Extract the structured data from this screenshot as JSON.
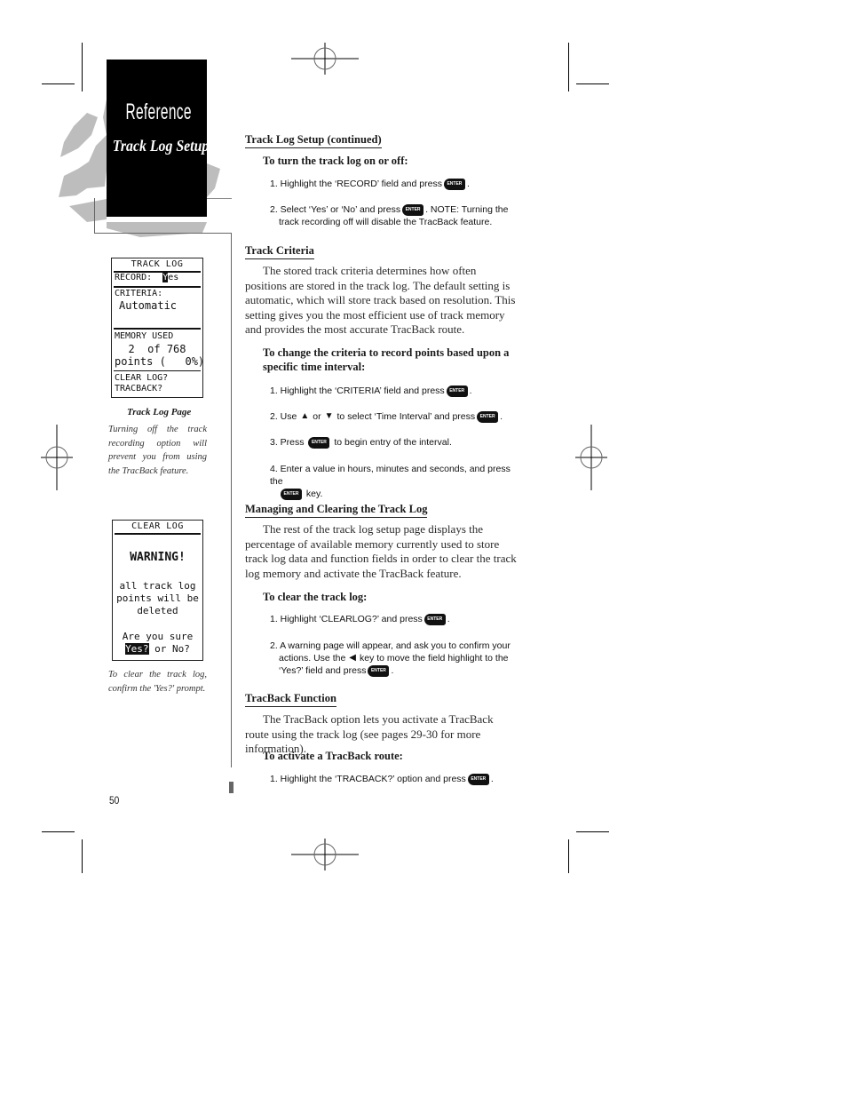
{
  "header": {
    "section": "Reference",
    "subsection": "Track Log Setup"
  },
  "sidebar": {
    "screen1": {
      "title": "TRACK LOG",
      "record_label": "RECORD:",
      "record_value_hl": "Y",
      "record_value_rest": "es",
      "criteria_label": "CRITERIA:",
      "criteria_value": "Automatic",
      "memory_label": "MEMORY USED",
      "memory_line1": "2  of 768",
      "memory_line2": "points (   0%)",
      "clear_log": "CLEAR LOG?",
      "tracback": "TRACBACK?"
    },
    "caption1_title": "Track Log Page",
    "caption1_text": "Turning off the track recording option will prevent you from using the TracBack feature.",
    "screen2": {
      "title": "CLEAR LOG",
      "warning": "WARNING!",
      "msg1": "all track log",
      "msg2": "points will be",
      "msg3": "deleted",
      "confirm": "Are you sure",
      "yes": "Yes?",
      "no": " or No?"
    },
    "caption2_text": "To clear the track log, confirm the 'Yes?' prompt."
  },
  "main": {
    "s1_heading": "Track Log Setup (continued)",
    "s1_sub": "To turn the track log on or off:",
    "s1_step1_a": "1. Highlight the ‘RECORD’ field and press",
    "s1_step1_b": ".",
    "s1_step2_a": "2. Select ‘Yes’ or ‘No’ and press",
    "s1_step2_b": ". NOTE: Turning the",
    "s1_step2_c": "track recording off will disable the TracBack feature.",
    "s2_heading": "Track Criteria",
    "s2_para": "The stored track criteria determines how often positions are stored in the track log. The default setting is automatic, which will store track based on resolution. This setting gives you the most efficient use of track memory and provides the most accurate TracBack route.",
    "s2_sub": "To change the criteria to record points based upon a specific time interval:",
    "s2_step1_a": "1. Highlight the ‘CRITERIA’ field and press",
    "s2_step1_b": ".",
    "s2_step2_a": "2. Use",
    "s2_step2_or": "or",
    "s2_step2_b": "to select ‘Time Interval’ and press",
    "s2_step2_c": ".",
    "s2_step3_a": "3. Press",
    "s2_step3_b": "to begin entry of the interval.",
    "s2_step4_a": "4. Enter a value in hours, minutes and seconds, and press the",
    "s2_step4_b": "key.",
    "s3_heading": "Managing and Clearing the Track Log",
    "s3_para": "The rest of the track log setup page displays the percentage of available memory currently used to store track log data and function fields in order to clear the track log memory and activate the TracBack feature.",
    "s3_sub": "To clear the track log:",
    "s3_step1_a": "1. Highlight ‘CLEARLOG?’ and press",
    "s3_step1_b": ".",
    "s3_step2_a": "2. A warning page will appear, and ask you to confirm your",
    "s3_step2_b": "actions. Use the",
    "s3_step2_c": "key to move the field highlight to the",
    "s3_step2_d": "‘Yes?’ field and press",
    "s3_step2_e": ".",
    "s4_heading": "TracBack Function",
    "s4_para": "The TracBack option lets you activate a TracBack route using the track log (see pages 29-30 for more information).",
    "s4_sub": "To activate a TracBack route:",
    "s4_step1_a": "1. Highlight the ‘TRACBACK?’ option and press",
    "s4_step1_b": "."
  },
  "icons": {
    "enter_key_label": "ENTER",
    "up_arrow": "▲",
    "down_arrow": "▼",
    "left_arrow": "◀"
  },
  "footer": {
    "page_number": "50"
  }
}
